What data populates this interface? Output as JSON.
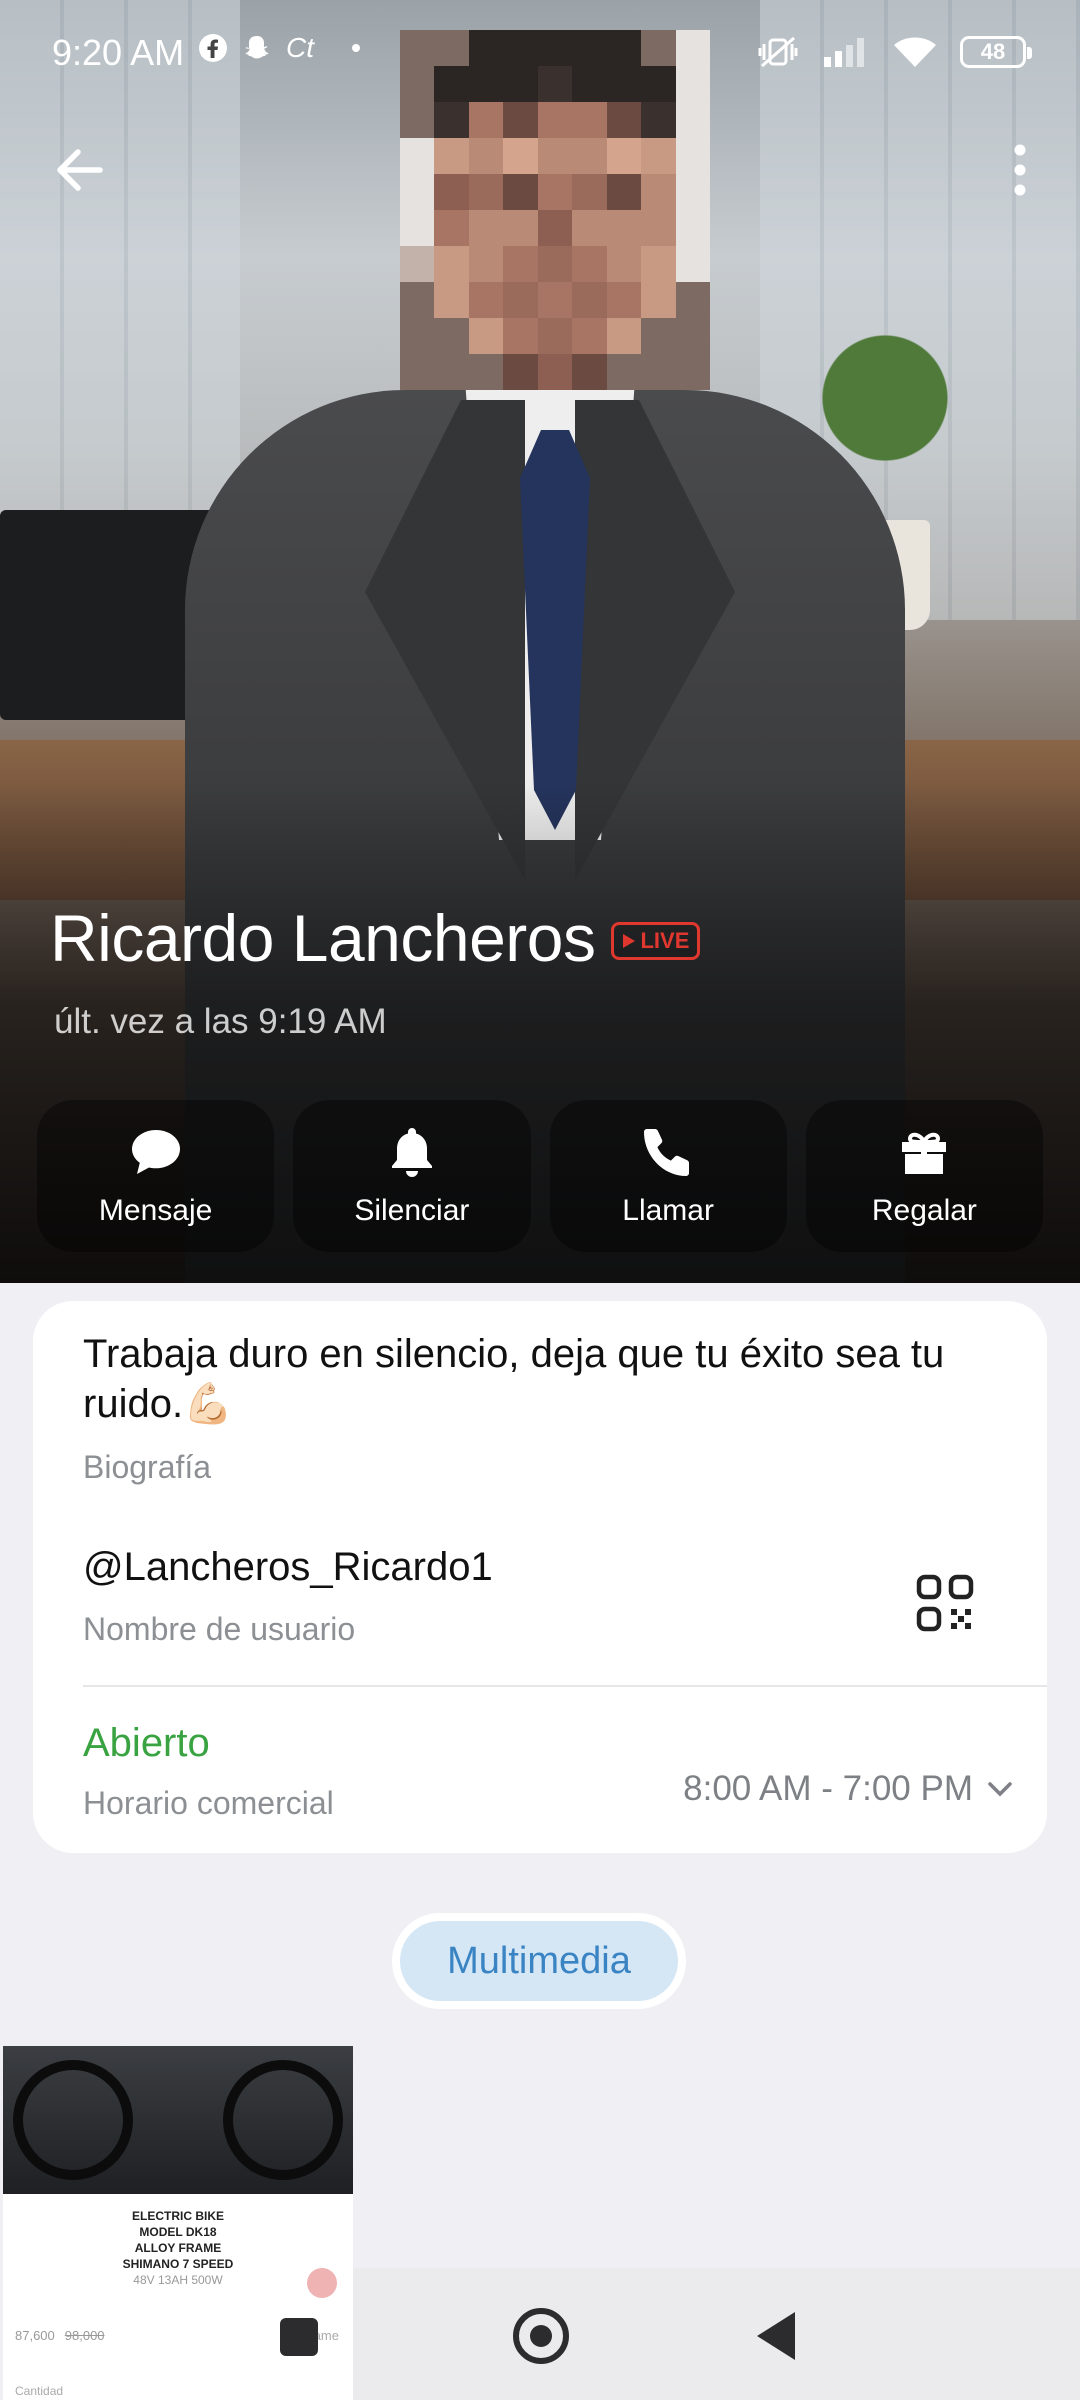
{
  "status_bar": {
    "time": "9:20 AM",
    "left_icons": [
      "facebook-icon",
      "snapchat-icon",
      "ct-icon",
      "dot-icon"
    ],
    "ct_text": "Ct",
    "right_icons": [
      "muted-vibrate-icon",
      "signal-icon",
      "wifi-icon"
    ],
    "battery": "48"
  },
  "profile": {
    "name": "Ricardo Lancheros",
    "live_badge": "LIVE",
    "last_seen": "últ. vez a las 9:19 AM"
  },
  "actions": [
    {
      "label": "Mensaje",
      "icon": "message-icon"
    },
    {
      "label": "Silenciar",
      "icon": "bell-icon"
    },
    {
      "label": "Llamar",
      "icon": "phone-icon"
    },
    {
      "label": "Regalar",
      "icon": "gift-icon"
    }
  ],
  "info": {
    "bio": "Trabaja duro en silencio, deja que tu éxito sea tu ruido.💪🏻",
    "bio_label": "Biografía",
    "username": "@Lancheros_Ricardo1",
    "username_label": "Nombre de usuario",
    "hours_status": "Abierto",
    "hours_label": "Horario comercial",
    "hours_range": "8:00 AM - 7:00 PM"
  },
  "media": {
    "tab_label": "Multimedia",
    "thumb": {
      "lines": [
        "ELECTRIC BIKE",
        "MODEL DK18",
        "ALLOY FRAME",
        "SHIMANO 7 SPEED"
      ],
      "sub": "48V 13AH 500W",
      "price": "87,600",
      "old_price": "98,000",
      "game": "Game",
      "qty_label": "Cantidad"
    }
  },
  "colors": {
    "accent_blue": "#3a84c4",
    "open_green": "#3aa341",
    "live_red": "#e0372e"
  }
}
